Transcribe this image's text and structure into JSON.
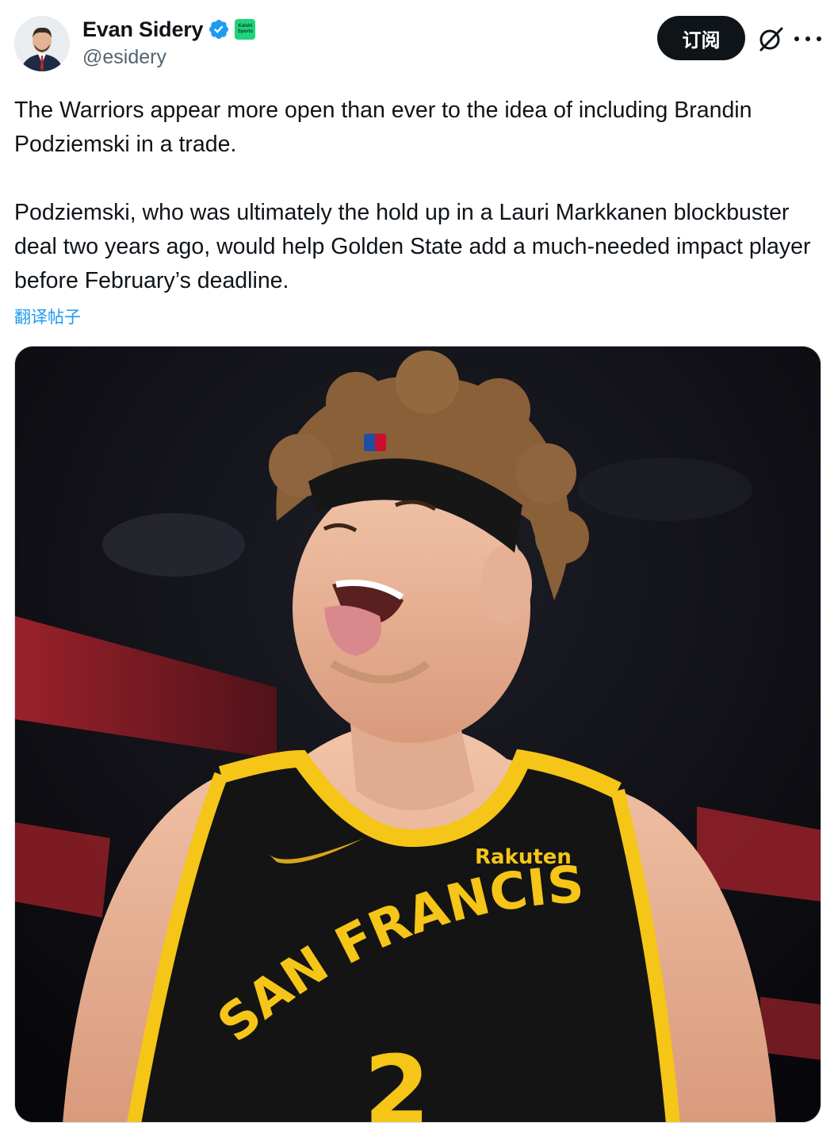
{
  "tweet": {
    "author": {
      "display_name": "Evan Sidery",
      "handle": "@esidery",
      "verified": true,
      "affiliate_badge": {
        "line1": "Kalshi",
        "line2": "Sports",
        "color": "#1fd37c"
      }
    },
    "actions": {
      "subscribe_label": "订阅"
    },
    "text": {
      "paragraph1": "The Warriors appear more open than ever to the idea of including Brandin Podziemski in a trade.",
      "paragraph2": "Podziemski, who was ultimately the hold up in a Lauri Markkanen blockbuster deal two years ago, would help Golden State add a much-needed impact player before February’s deadline."
    },
    "translate_label": "翻译帖子",
    "media": {
      "jersey_sponsor": "Rakuten",
      "jersey_city": "SAN FRANCISCO",
      "jersey_number": "2",
      "headband_logo": "NBA"
    }
  },
  "colors": {
    "text_primary": "#0f1419",
    "text_secondary": "#536471",
    "link": "#1d9bf0",
    "verified": "#1d9bf0",
    "jersey_gold": "#f5c518",
    "jersey_black": "#141414"
  },
  "icons": {
    "verified": "verified-check-icon",
    "grok": "grok-icon",
    "more": "more-horizontal-icon"
  }
}
